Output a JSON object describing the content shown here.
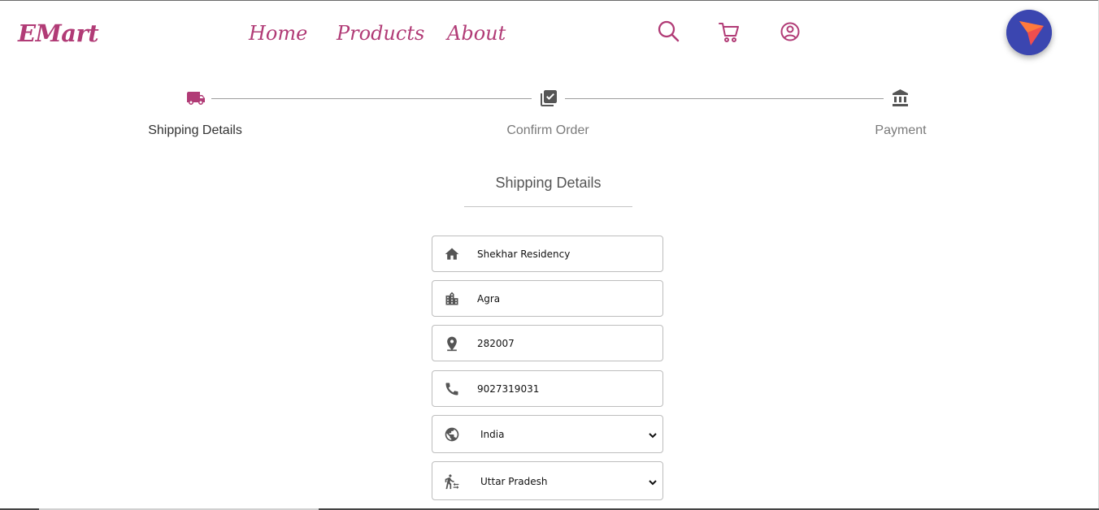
{
  "brand": {
    "name": "EMart",
    "color": "#b13b76"
  },
  "nav": {
    "links": [
      {
        "label": "Home"
      },
      {
        "label": "Products"
      },
      {
        "label": "About"
      }
    ],
    "icons": [
      "search-icon",
      "cart-icon",
      "account-circle-icon"
    ]
  },
  "stepper": {
    "active_step": 0,
    "steps": [
      {
        "label": "Shipping Details",
        "icon": "truck-icon"
      },
      {
        "label": "Confirm Order",
        "icon": "checklist-icon"
      },
      {
        "label": "Payment",
        "icon": "bank-icon"
      }
    ],
    "colors": {
      "active_icon": "#b13b76",
      "inactive_icon": "#555555",
      "active_label": "#333333",
      "inactive_label": "#7a7a7a"
    }
  },
  "form": {
    "title": "Shipping Details",
    "fields": [
      {
        "icon": "home-icon",
        "value": "Shekhar Residency"
      },
      {
        "icon": "city-icon",
        "value": "Agra"
      },
      {
        "icon": "location-pin-icon",
        "value": "282007"
      },
      {
        "icon": "phone-icon",
        "value": "9027319031"
      }
    ],
    "country": {
      "icon": "globe-icon",
      "selected": "India"
    },
    "state": {
      "icon": "transfer-within-station-icon",
      "selected": "Uttar Pradesh"
    }
  }
}
